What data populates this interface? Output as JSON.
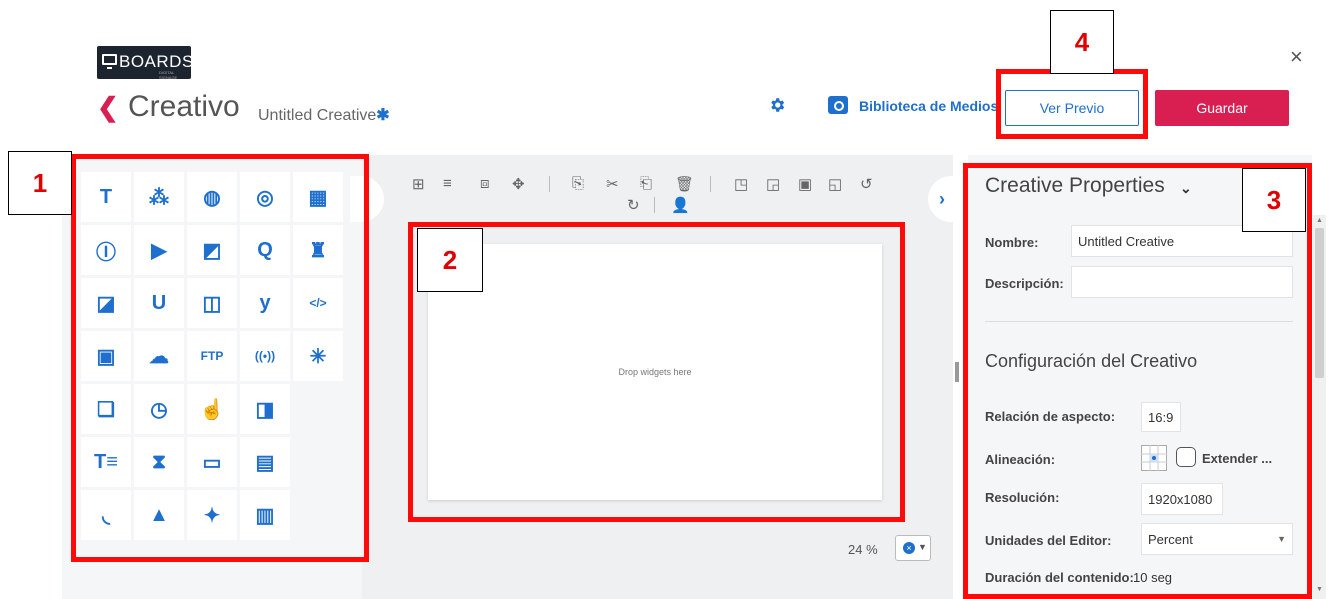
{
  "header": {
    "logo_text": "BOARDS",
    "logo_sub": "DIGITAL SIGNAGE",
    "back_icon": "chevron-left-icon",
    "title": "Creativo",
    "subtitle": "Untitled Creative",
    "unsaved_marker": "✱",
    "media_library_label": "Biblioteca de Medios",
    "preview_label": "Ver Previo",
    "save_label": "Guardar",
    "close_label": "×"
  },
  "colors": {
    "accent": "#1f6fce",
    "brand": "#d91f52",
    "annotation": "#ff0a0a"
  },
  "widgets": [
    {
      "icon": "text-icon",
      "glyph": "T"
    },
    {
      "icon": "rss-feed-icon",
      "glyph": "⁂"
    },
    {
      "icon": "globe-icon",
      "glyph": "◍"
    },
    {
      "icon": "instagram-icon",
      "glyph": "◎"
    },
    {
      "icon": "table-icon",
      "glyph": "▦"
    },
    {
      "icon": "text-box-icon",
      "glyph": "Ⓘ"
    },
    {
      "icon": "youtube-icon",
      "glyph": "▶"
    },
    {
      "icon": "web-image-icon",
      "glyph": "◩"
    },
    {
      "icon": "q-icon",
      "glyph": "Q"
    },
    {
      "icon": "queue-icon",
      "glyph": "♜"
    },
    {
      "icon": "image-icon",
      "glyph": "◪"
    },
    {
      "icon": "u-icon",
      "glyph": "U"
    },
    {
      "icon": "web-video-icon",
      "glyph": "◫"
    },
    {
      "icon": "yammer-icon",
      "glyph": "y"
    },
    {
      "icon": "html-code-icon",
      "glyph": "</>"
    },
    {
      "icon": "video-icon",
      "glyph": "▣"
    },
    {
      "icon": "weather-icon",
      "glyph": "☁"
    },
    {
      "icon": "ftp-icon",
      "glyph": "FTP"
    },
    {
      "icon": "broadcast-icon",
      "glyph": "((•))"
    },
    {
      "icon": "loading-spinner-icon",
      "glyph": "✳"
    },
    {
      "icon": "gallery-icon",
      "glyph": "❏"
    },
    {
      "icon": "clock-icon",
      "glyph": "◷"
    },
    {
      "icon": "touch-icon",
      "glyph": "☝"
    },
    {
      "icon": "image-ad-icon",
      "glyph": "◨"
    },
    {
      "icon": "text-list-icon",
      "glyph": "T≡"
    },
    {
      "icon": "hourglass-icon",
      "glyph": "⧗"
    },
    {
      "icon": "screen-icon",
      "glyph": "▭"
    },
    {
      "icon": "calendar-icon",
      "glyph": "▤"
    },
    {
      "icon": "rss-icon",
      "glyph": "◟"
    },
    {
      "icon": "shapes-icon",
      "glyph": "▲"
    },
    {
      "icon": "twitter-icon",
      "glyph": "✦"
    },
    {
      "icon": "bar-chart-icon",
      "glyph": "▥"
    }
  ],
  "toolbar": {
    "icons": [
      "grid-icon",
      "align-icon",
      "frame-icon",
      "move-icon",
      "copy-icon",
      "cut-icon",
      "paste-icon",
      "trash-icon",
      "bring-front-icon",
      "send-back-icon",
      "bring-forward-icon",
      "send-backward-icon",
      "undo-icon",
      "redo-icon",
      "add-user-icon"
    ],
    "glyphs": [
      "⊞",
      "≡",
      "⧈",
      "✥",
      "⎘",
      "✂",
      "⎗",
      "🗑",
      "◳",
      "◲",
      "▣",
      "◱",
      "↺",
      "↻",
      "👤"
    ]
  },
  "canvas": {
    "placeholder": "Drop widgets here"
  },
  "zoom": {
    "value": "24 %"
  },
  "properties": {
    "title": "Creative Properties",
    "name_label": "Nombre:",
    "name_value": "Untitled Creative",
    "description_label": "Descripción:",
    "description_value": "",
    "config_title": "Configuración del Creativo",
    "aspect_label": "Relación de aspecto:",
    "aspect_value": "16:9",
    "align_label": "Alineación:",
    "extend_label": "Extender ...",
    "resolution_label": "Resolución:",
    "resolution_value": "1920x1080",
    "units_label": "Unidades del Editor:",
    "units_value": "Percent",
    "duration_label": "Duración del contenido:",
    "duration_value": "10 seg"
  },
  "annotations": [
    "1",
    "2",
    "3",
    "4"
  ]
}
